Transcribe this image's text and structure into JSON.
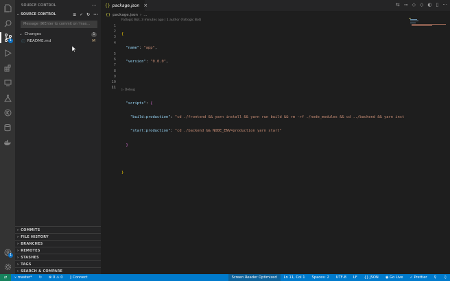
{
  "sidebar": {
    "title": "SOURCE CONTROL",
    "section": "SOURCE CONTROL",
    "message_placeholder": "Message (⌘Enter to commit on 'mas...",
    "changes_label": "Changes",
    "changes_count": "1",
    "file_name": "README.md",
    "file_status": "M",
    "sections": [
      "COMMITS",
      "FILE HISTORY",
      "BRANCHES",
      "REMOTES",
      "STASHES",
      "TAGS",
      "SEARCH & COMPARE"
    ]
  },
  "activity": {
    "scm_badge": "1",
    "account_badge": "1"
  },
  "editor": {
    "tab_label": "package.json",
    "breadcrumb_file": "package.json",
    "breadcrumb_more": "...",
    "blame": "Fatlogic Bot, 3 minutes ago | 1 author (Fatlogic Bot)",
    "line_numbers": [
      "1",
      "2",
      "3",
      "4",
      "5",
      "6",
      "7",
      "8",
      "9",
      "10",
      "11"
    ],
    "debug_lens": "Debug",
    "name_key": "\"name\"",
    "name_val": "\"app\"",
    "version_key": "\"version\"",
    "version_val": "\"0.0.0\"",
    "scripts_key": "\"scripts\"",
    "build_key": "\"build:production\"",
    "build_val": "\"cd ./frontend && yarn install && yarn run build && rm -rf ./node_modules && cd ../backend && yarn inst",
    "start_key": "\"start:production\"",
    "start_val": "\"cd ./backend && NODE_ENV=production yarn start\""
  },
  "status": {
    "branch": "master*",
    "problems": "0 ⚠ 0",
    "connect": "Connect",
    "screen_reader": "Screen Reader Optimized",
    "position": "Ln 11, Col 1",
    "spaces": "Spaces: 2",
    "encoding": "UTF-8",
    "eol": "LF",
    "language": "JSON",
    "golive": "Go Live",
    "prettier": "Prettier"
  },
  "colors": {
    "accent": "#007acc",
    "activity_bar": "#333333",
    "sidebar": "#252526",
    "editor": "#1e1e1e",
    "modified": "#e2c08d"
  }
}
